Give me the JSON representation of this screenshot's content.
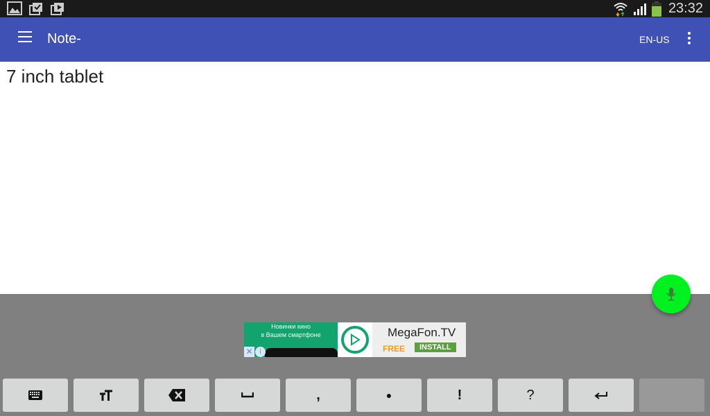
{
  "status_bar": {
    "notification_icons": [
      "gallery-icon",
      "clipboard-check-icon",
      "media-play-bag-icon"
    ],
    "system_icons": [
      "wifi-icon",
      "signal-icon",
      "battery-icon"
    ],
    "time": "23:32",
    "battery_color": "#8bc34a"
  },
  "app_bar": {
    "title": "Note-",
    "language": "EN-US",
    "color": "#3f51b5"
  },
  "editor": {
    "value": "7 inch tablet"
  },
  "fab": {
    "icon": "mic-icon",
    "color": "#00f020"
  },
  "ad": {
    "left_line1": "Новинки кино",
    "left_line2": "в Вашем смартфоне",
    "brand": "MegaFon.TV",
    "free_label": "FREE",
    "install_label": "INSTALL",
    "close_glyph": "✕",
    "info_glyph": "i"
  },
  "keyboard": {
    "keys": [
      {
        "name": "keyboard-key",
        "glyph": "⌨",
        "icon": "keyboard-icon"
      },
      {
        "name": "text-size-key",
        "glyph": "тТ",
        "icon": "text-size-icon"
      },
      {
        "name": "backspace-key",
        "glyph": "",
        "icon": "backspace-icon"
      },
      {
        "name": "space-key",
        "glyph": "␣",
        "icon": "space-icon"
      },
      {
        "name": "comma-key",
        "glyph": ","
      },
      {
        "name": "period-key",
        "glyph": "●"
      },
      {
        "name": "exclamation-key",
        "glyph": "!"
      },
      {
        "name": "question-key",
        "glyph": "?"
      },
      {
        "name": "enter-key",
        "glyph": "↵",
        "icon": "enter-icon"
      },
      {
        "name": "blank-key",
        "glyph": ""
      }
    ]
  }
}
